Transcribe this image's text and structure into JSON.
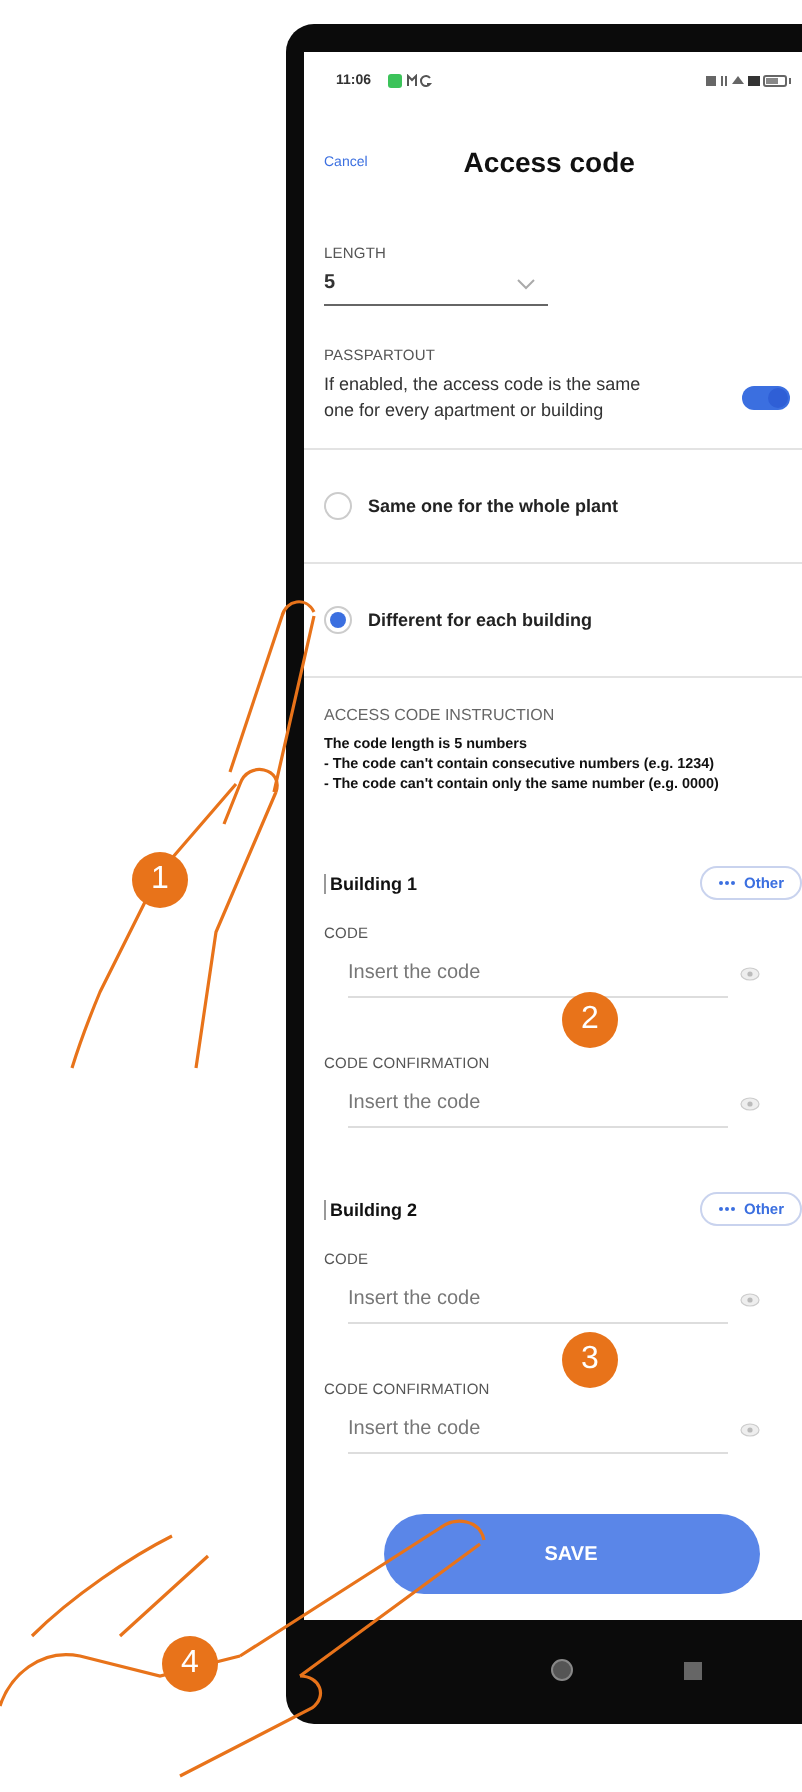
{
  "status_bar": {
    "time": "11:06"
  },
  "header": {
    "cancel": "Cancel",
    "title": "Access code"
  },
  "length": {
    "label": "LENGTH",
    "value": "5"
  },
  "passpartout": {
    "label": "PASSPARTOUT",
    "description": "If enabled, the access code is the same one for every apartment or building",
    "on": true
  },
  "options": [
    {
      "label": "Same one for the whole plant",
      "selected": false
    },
    {
      "label": "Different for each building",
      "selected": true
    }
  ],
  "instructions": {
    "title": "ACCESS CODE INSTRUCTION",
    "lines": [
      "The code length is 5 numbers",
      "- The code can't contain consecutive numbers (e.g. 1234)",
      "- The code can't contain only the same number (e.g. 0000)"
    ]
  },
  "buildings": [
    {
      "name": "Building 1",
      "other": "Other",
      "fields": [
        {
          "label": "CODE",
          "placeholder": "Insert the code"
        },
        {
          "label": "CODE CONFIRMATION",
          "placeholder": "Insert the code"
        }
      ]
    },
    {
      "name": "Building 2",
      "other": "Other",
      "fields": [
        {
          "label": "CODE",
          "placeholder": "Insert the code"
        },
        {
          "label": "CODE CONFIRMATION",
          "placeholder": "Insert the code"
        }
      ]
    }
  ],
  "save": "SAVE",
  "steps": [
    "1",
    "2",
    "3",
    "4"
  ]
}
